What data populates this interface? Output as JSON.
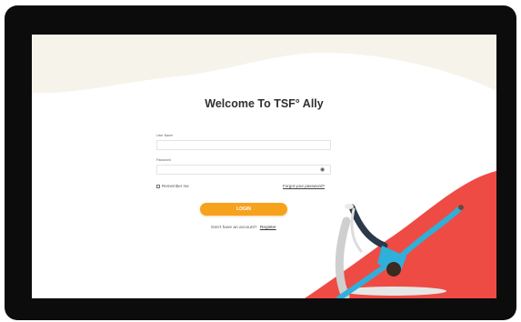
{
  "title": "Welcome To TSF° Ally",
  "username": {
    "label": "User Name",
    "value": ""
  },
  "password": {
    "label": "Password",
    "value": ""
  },
  "remember_label": "Remember me",
  "forgot_label": "Forgot your password?",
  "login_label": "LOGIN",
  "no_account_text": "Don't have an account?",
  "register_label": "Register",
  "colors": {
    "accent": "#f6a21c",
    "decor_red": "#ef4b45",
    "cream": "#f6f3ea",
    "bezel": "#0c0c0c"
  },
  "icons": {
    "eye": "eye-icon"
  }
}
